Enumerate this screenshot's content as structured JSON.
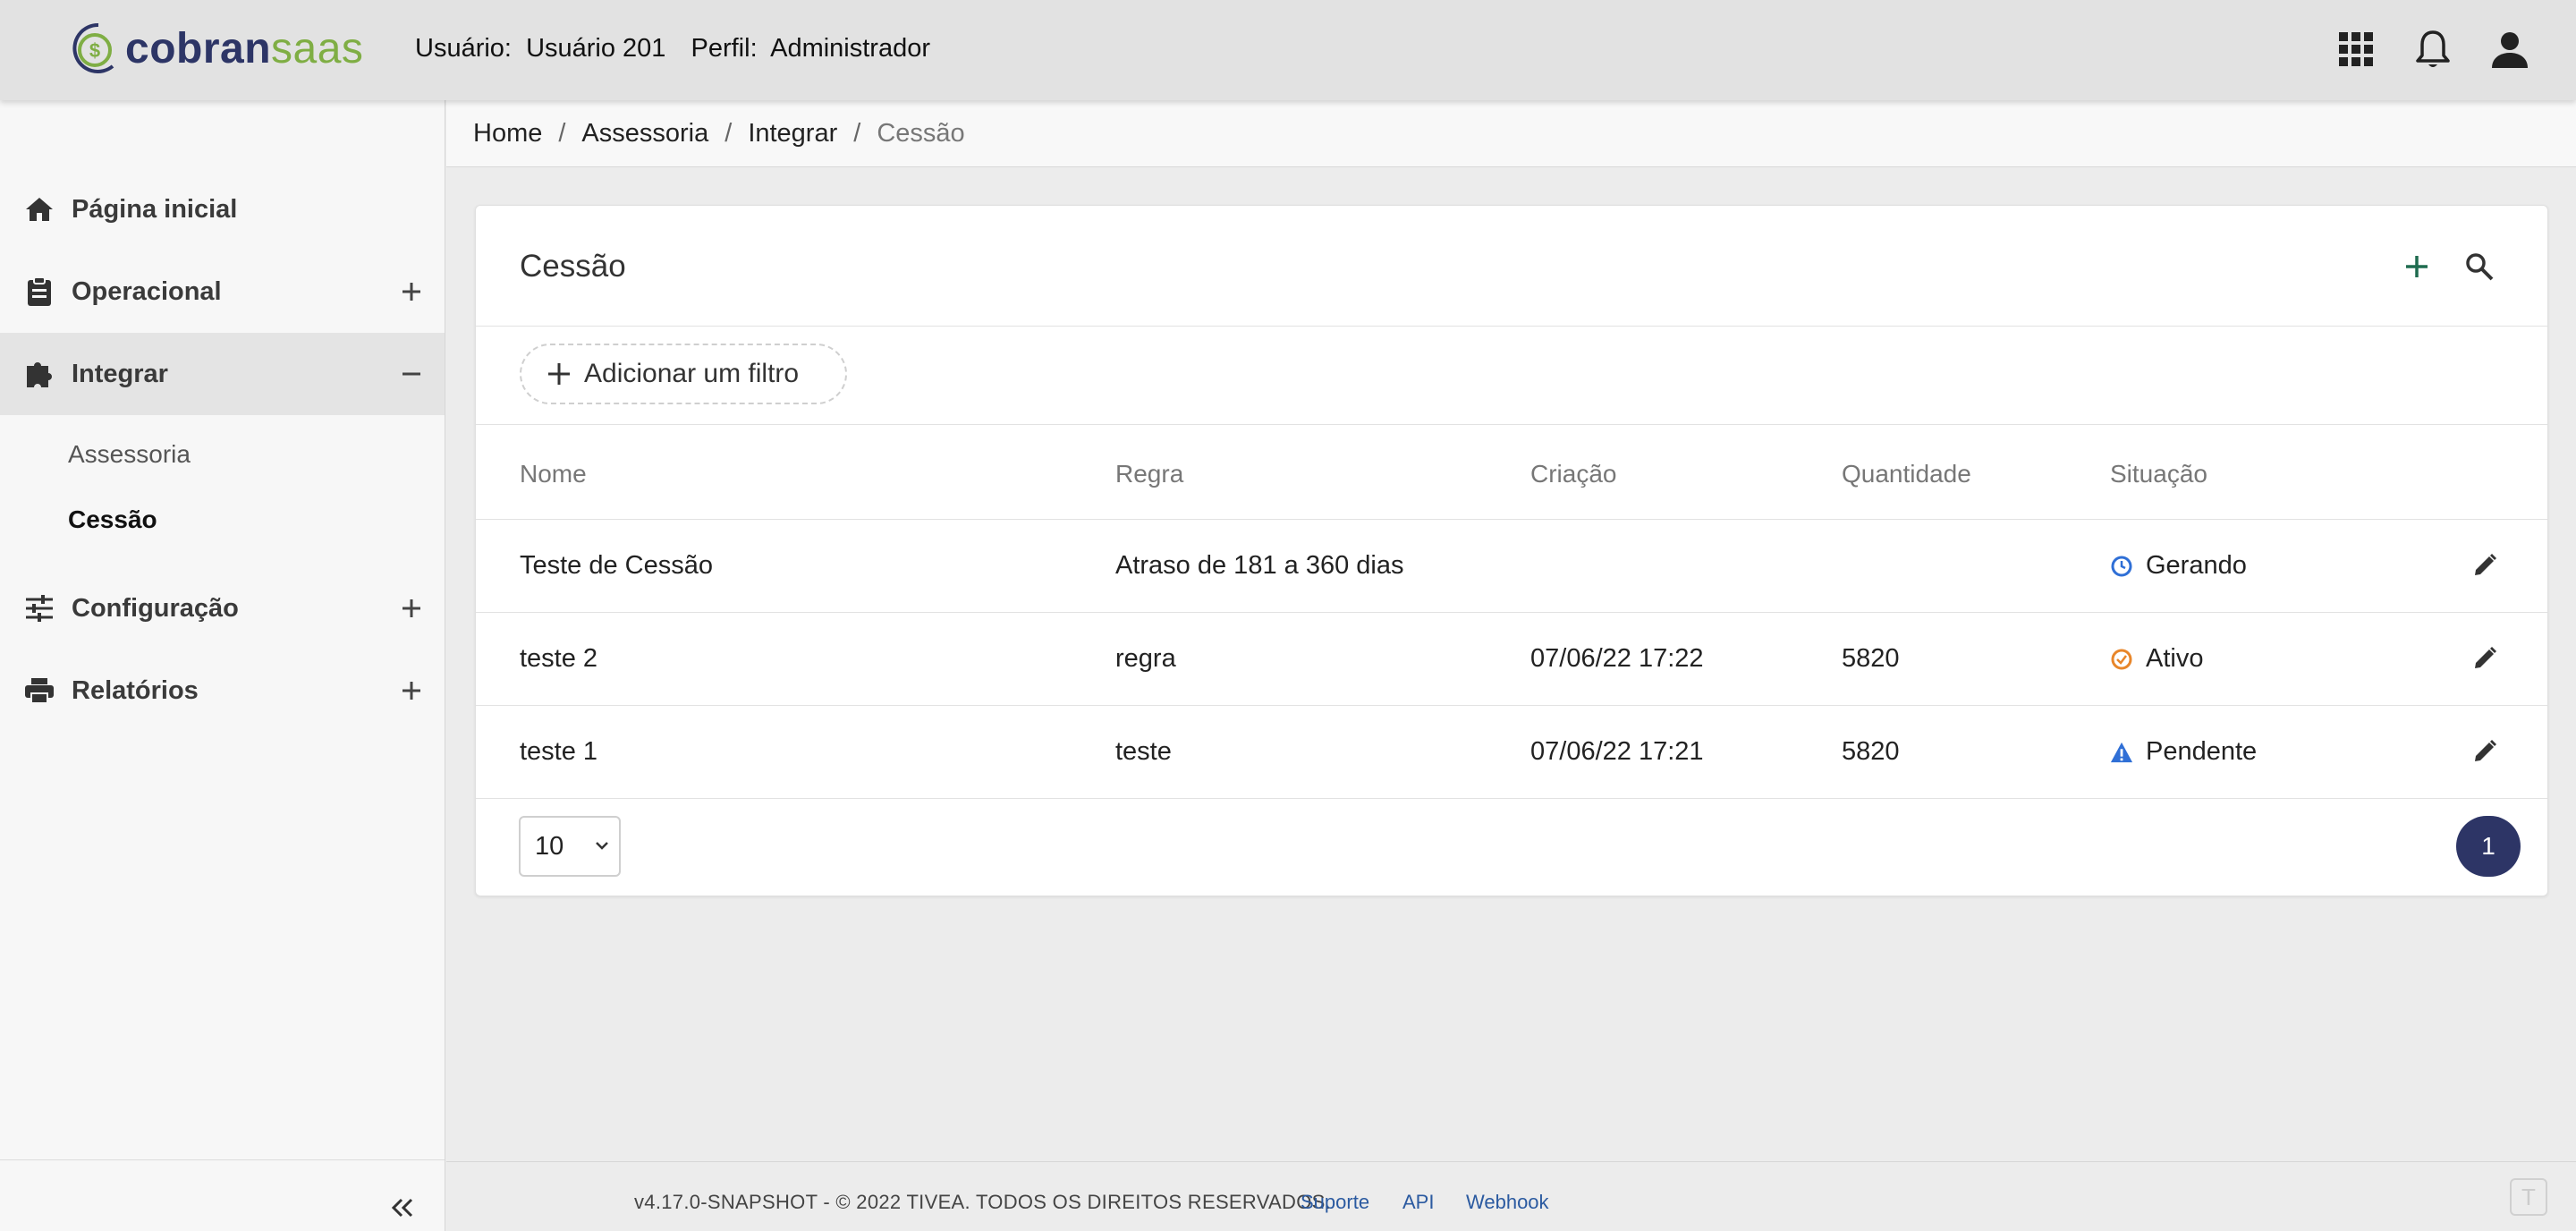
{
  "header": {
    "logo_text_part1": "cobran",
    "logo_text_part2": "saas",
    "user_label": "Usuário:",
    "user_value": "Usuário 201",
    "profile_label": "Perfil:",
    "profile_value": "Administrador",
    "icons": [
      "apps-grid-icon",
      "bell-icon",
      "user-account-icon"
    ]
  },
  "sidebar": {
    "items": [
      {
        "label": "Página inicial",
        "icon": "home-icon"
      },
      {
        "label": "Operacional",
        "icon": "clipboard-icon",
        "toggle": "plus"
      },
      {
        "label": "Integrar",
        "icon": "puzzle-icon",
        "toggle": "minus",
        "active": true
      },
      {
        "label": "Configuração",
        "icon": "sliders-icon",
        "toggle": "plus"
      },
      {
        "label": "Relatórios",
        "icon": "printer-icon",
        "toggle": "plus"
      }
    ],
    "subitems": [
      {
        "label": "Assessoria"
      },
      {
        "label": "Cessão",
        "active": true
      }
    ],
    "collapse_icon": "double-chevron-left-icon"
  },
  "breadcrumb": [
    "Home",
    "Assessoria",
    "Integrar",
    "Cessão"
  ],
  "card": {
    "title": "Cessão",
    "filter_label": "Adicionar um filtro",
    "columns": [
      "Nome",
      "Regra",
      "Criação",
      "Quantidade",
      "Situação"
    ],
    "rows": [
      {
        "nome": "Teste de Cessão",
        "regra": "Atraso de 181 a 360 dias",
        "criacao": "",
        "quantidade": "",
        "situacao": "Gerando",
        "status_icon": "clock-icon",
        "status_color": "#2f6fd6"
      },
      {
        "nome": "teste 2",
        "regra": "regra",
        "criacao": "07/06/22 17:22",
        "quantidade": "5820",
        "situacao": "Ativo",
        "status_icon": "check-circle-icon",
        "status_color": "#e8862a"
      },
      {
        "nome": "teste 1",
        "regra": "teste",
        "criacao": "07/06/22 17:21",
        "quantidade": "5820",
        "situacao": "Pendente",
        "status_icon": "warning-icon",
        "status_color": "#2f6fd6"
      }
    ],
    "page_size": "10",
    "current_page": "1"
  },
  "footer": {
    "version_text": "v4.17.0-SNAPSHOT - © 2022 TIVEA. TODOS OS DIREITOS RESERVADOS.",
    "links": [
      "Suporte",
      "API",
      "Webhook"
    ]
  },
  "colors": {
    "brand_dark": "#2d3566",
    "brand_green": "#7fae44",
    "link_blue": "#2b5aa0",
    "add_green": "#1f6b4f"
  }
}
